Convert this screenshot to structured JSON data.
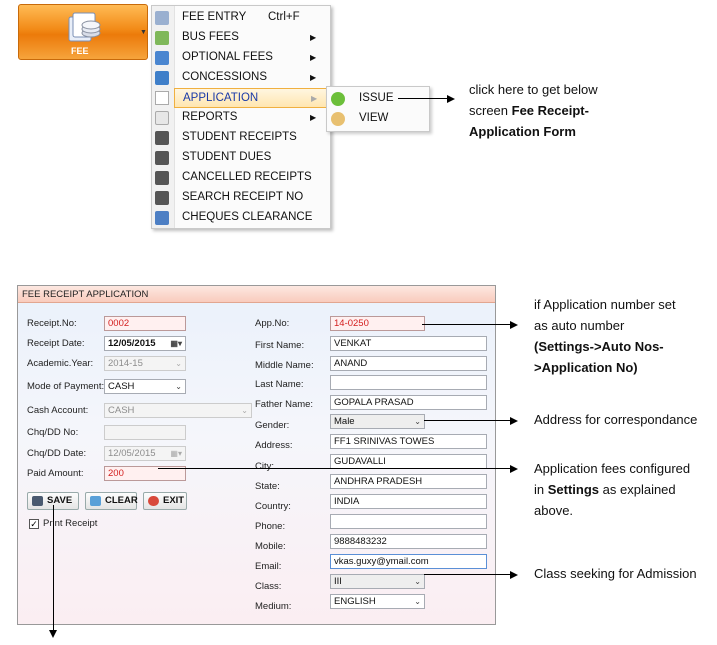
{
  "ribbon": {
    "fee_label": "FEE"
  },
  "menu": {
    "items": [
      {
        "label": "FEE ENTRY",
        "shortcut": "Ctrl+F",
        "icon": "fee-entry-icon"
      },
      {
        "label": "BUS FEES",
        "icon": "bus-icon"
      },
      {
        "label": "OPTIONAL FEES",
        "icon": "optional-fees-icon"
      },
      {
        "label": "CONCESSIONS",
        "icon": "concessions-icon"
      },
      {
        "label": "APPLICATION",
        "icon": "application-icon"
      },
      {
        "label": "REPORTS",
        "icon": "reports-icon"
      },
      {
        "label": "STUDENT RECEIPTS",
        "icon": "binoculars-icon"
      },
      {
        "label": "STUDENT DUES",
        "icon": "binoculars-icon"
      },
      {
        "label": "CANCELLED RECEIPTS",
        "icon": "binoculars-icon"
      },
      {
        "label": "SEARCH RECEIPT NO",
        "icon": "binoculars-icon"
      },
      {
        "label": "CHEQUES CLEARANCE",
        "icon": "cheque-icon"
      }
    ],
    "submenu": [
      {
        "label": "ISSUE",
        "icon": "plus-icon"
      },
      {
        "label": "VIEW",
        "icon": "magnifier-icon"
      }
    ]
  },
  "notes": {
    "top_line1": "click here to get below",
    "top_line2_a": "screen ",
    "top_line2_b": "Fee Receipt-",
    "top_line3": "Application Form",
    "auto_line1": "if Application number set",
    "auto_line2": "as  auto number",
    "auto_line3": "(Settings->Auto Nos-",
    "auto_line4": ">Application No)",
    "address": "Address for correspondance",
    "fees_line1": "Application fees configured",
    "fees_line2_a": "in ",
    "fees_line2_b": "Settings",
    "fees_line2_c": " as explained",
    "fees_line3": "above.",
    "class": "Class seeking for Admission"
  },
  "form": {
    "title": "FEE RECEIPT APPLICATION",
    "left": {
      "receipt_no_label": "Receipt.No:",
      "receipt_no": "0002",
      "receipt_date_label": "Receipt Date:",
      "receipt_date": "12/05/2015",
      "academic_year_label": "Academic.Year:",
      "academic_year": "2014-15",
      "mode_label": "Mode of Payment:",
      "mode": "CASH",
      "cash_account_label": "Cash Account:",
      "cash_account": "CASH",
      "chq_no_label": "Chq/DD No:",
      "chq_no": "",
      "chq_date_label": "Chq/DD Date:",
      "chq_date": "12/05/2015",
      "paid_amount_label": "Paid Amount:",
      "paid_amount": "200",
      "print_receipt_label": "Print Receipt"
    },
    "buttons": {
      "save": "SAVE",
      "clear": "CLEAR",
      "exit": "EXIT"
    },
    "right": {
      "app_no_label": "App.No:",
      "app_no": "14-0250",
      "first_name_label": "First Name:",
      "first_name": "VENKAT",
      "middle_name_label": "Middle Name:",
      "middle_name": "ANAND",
      "last_name_label": "Last Name:",
      "last_name": "",
      "father_name_label": "Father Name:",
      "father_name": "GOPALA PRASAD",
      "gender_label": "Gender:",
      "gender": "Male",
      "address_label": "Address:",
      "address": "FF1 SRINIVAS TOWES",
      "city_label": "City:",
      "city": "GUDAVALLI",
      "state_label": "State:",
      "state": "ANDHRA PRADESH",
      "country_label": "Country:",
      "country": "INDIA",
      "phone_label": "Phone:",
      "phone": "",
      "mobile_label": "Mobile:",
      "mobile": "9888483232",
      "email_label": "Email:",
      "email": "vkas.guxy@ymail.com",
      "class_label": "Class:",
      "class": "III",
      "medium_label": "Medium:",
      "medium": "ENGLISH"
    }
  },
  "colors": {
    "ribbon": "#f28a17",
    "required_field_text": "#d41e1e",
    "highlight_text": "#1a3aa8"
  }
}
